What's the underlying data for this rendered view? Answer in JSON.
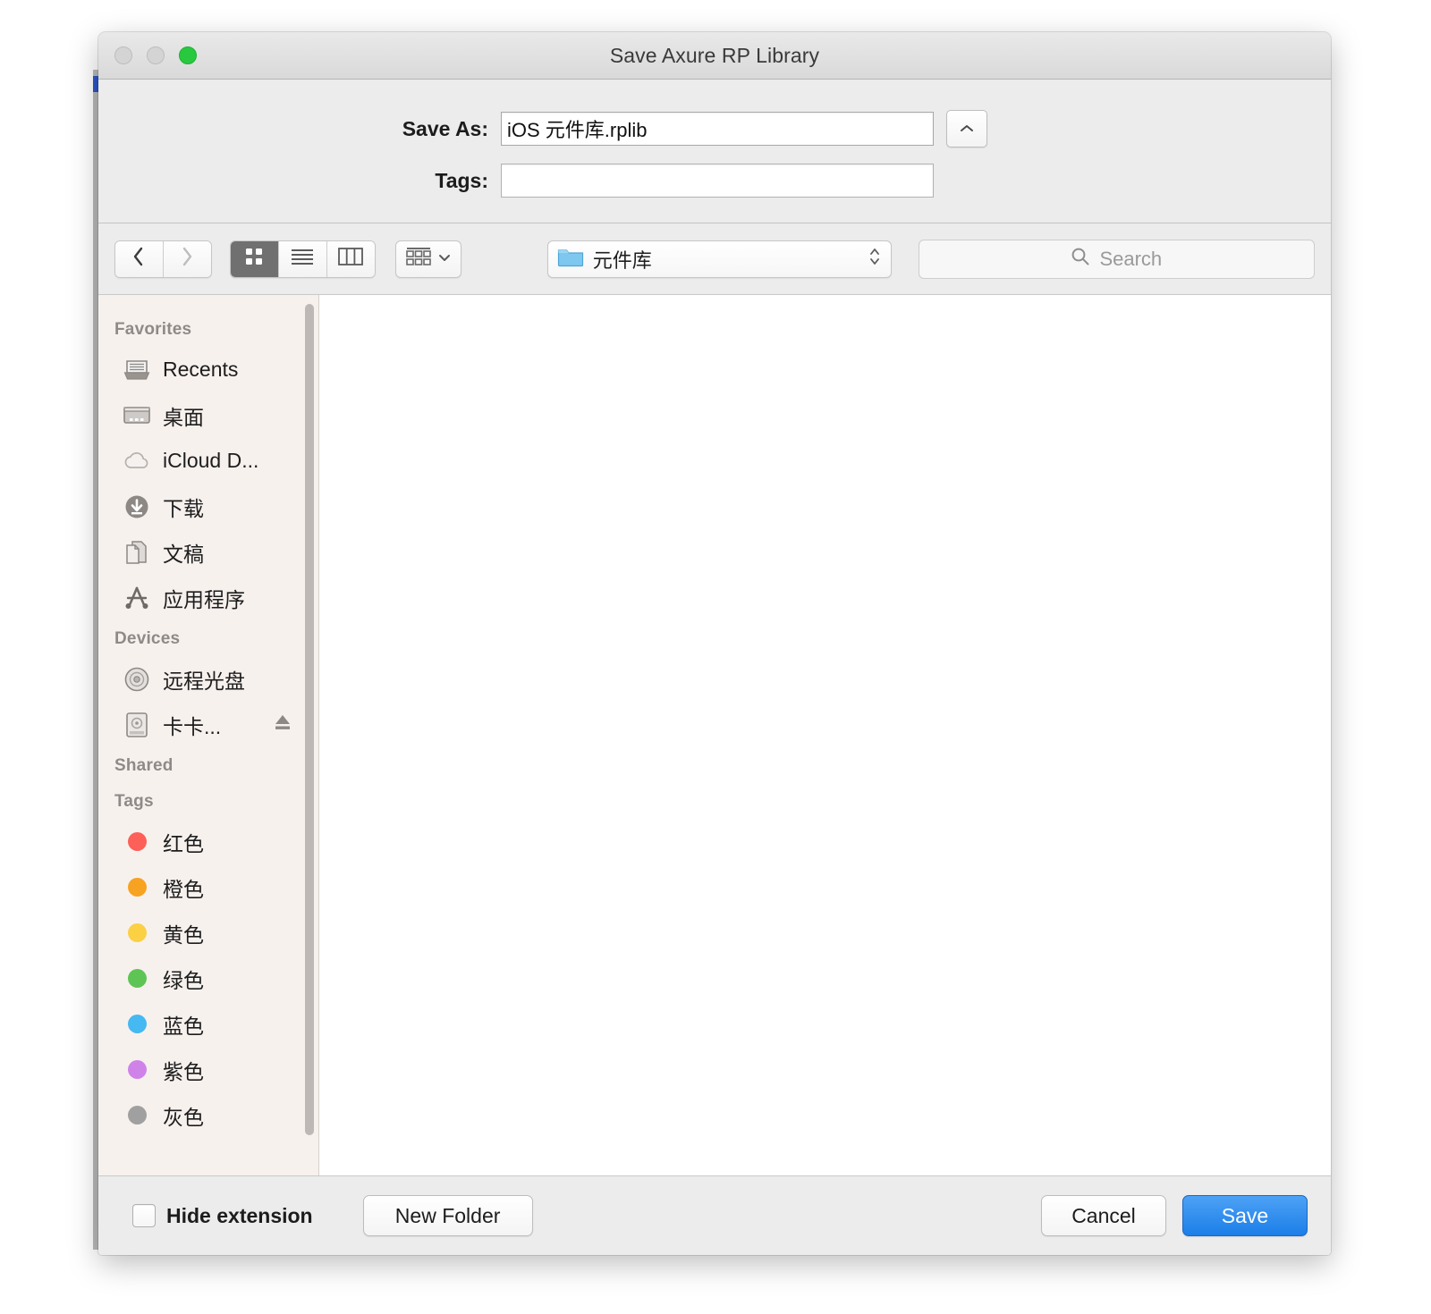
{
  "window": {
    "title": "Save Axure RP Library",
    "traffic_lights": [
      "close-button",
      "minimize-button",
      "zoom-button"
    ]
  },
  "form": {
    "save_as_label": "Save As:",
    "save_as_value": "iOS 元件库.rplib",
    "tags_label": "Tags:",
    "tags_value": "",
    "tags_placeholder": "",
    "expand_icon": "chevron-up-icon"
  },
  "toolbar": {
    "back_icon": "chevron-left-icon",
    "forward_icon": "chevron-right-icon",
    "view_icon_grid": "grid-view-icon",
    "view_icon_list": "list-view-icon",
    "view_icon_column": "column-view-icon",
    "arrange_icon": "arrange-icon",
    "arrange_chevron_icon": "chevron-down-icon",
    "active_view": "grid",
    "path_folder_icon": "folder-icon",
    "path_label": "元件库",
    "path_stepper_icon": "up-down-stepper-icon",
    "search_icon": "search-icon",
    "search_placeholder": "Search",
    "search_value": ""
  },
  "sidebar": {
    "sections": [
      {
        "heading": "Favorites",
        "items": [
          {
            "label": "Recents",
            "icon": "recents-icon"
          },
          {
            "label": "桌面",
            "icon": "desktop-icon"
          },
          {
            "label": "iCloud D...",
            "icon": "icloud-icon"
          },
          {
            "label": "下载",
            "icon": "downloads-icon"
          },
          {
            "label": "文稿",
            "icon": "documents-icon"
          },
          {
            "label": "应用程序",
            "icon": "applications-icon"
          }
        ]
      },
      {
        "heading": "Devices",
        "items": [
          {
            "label": "远程光盘",
            "icon": "optical-disc-icon"
          },
          {
            "label": "卡卡...",
            "icon": "hard-disk-icon",
            "eject": true,
            "eject_icon": "eject-icon"
          }
        ]
      },
      {
        "heading": "Shared",
        "items": []
      },
      {
        "heading": "Tags",
        "items": [
          {
            "label": "红色",
            "icon": "tag-dot-icon",
            "color": "#fc6058"
          },
          {
            "label": "橙色",
            "icon": "tag-dot-icon",
            "color": "#f8a222"
          },
          {
            "label": "黄色",
            "icon": "tag-dot-icon",
            "color": "#fbd043"
          },
          {
            "label": "绿色",
            "icon": "tag-dot-icon",
            "color": "#5ec554"
          },
          {
            "label": "蓝色",
            "icon": "tag-dot-icon",
            "color": "#46b8f2"
          },
          {
            "label": "紫色",
            "icon": "tag-dot-icon",
            "color": "#cf83e8"
          },
          {
            "label": "灰色",
            "icon": "tag-dot-icon",
            "color": "#a0a0a0"
          }
        ]
      }
    ]
  },
  "bottom": {
    "hide_extension_label": "Hide extension",
    "hide_extension_checked": false,
    "new_folder_label": "New Folder",
    "cancel_label": "Cancel",
    "save_label": "Save"
  },
  "colors": {
    "accent": "#1b7ee8",
    "sidebar_bg": "#f7f1ee",
    "window_bg": "#ececec",
    "zoom_light": "#28c93f"
  }
}
